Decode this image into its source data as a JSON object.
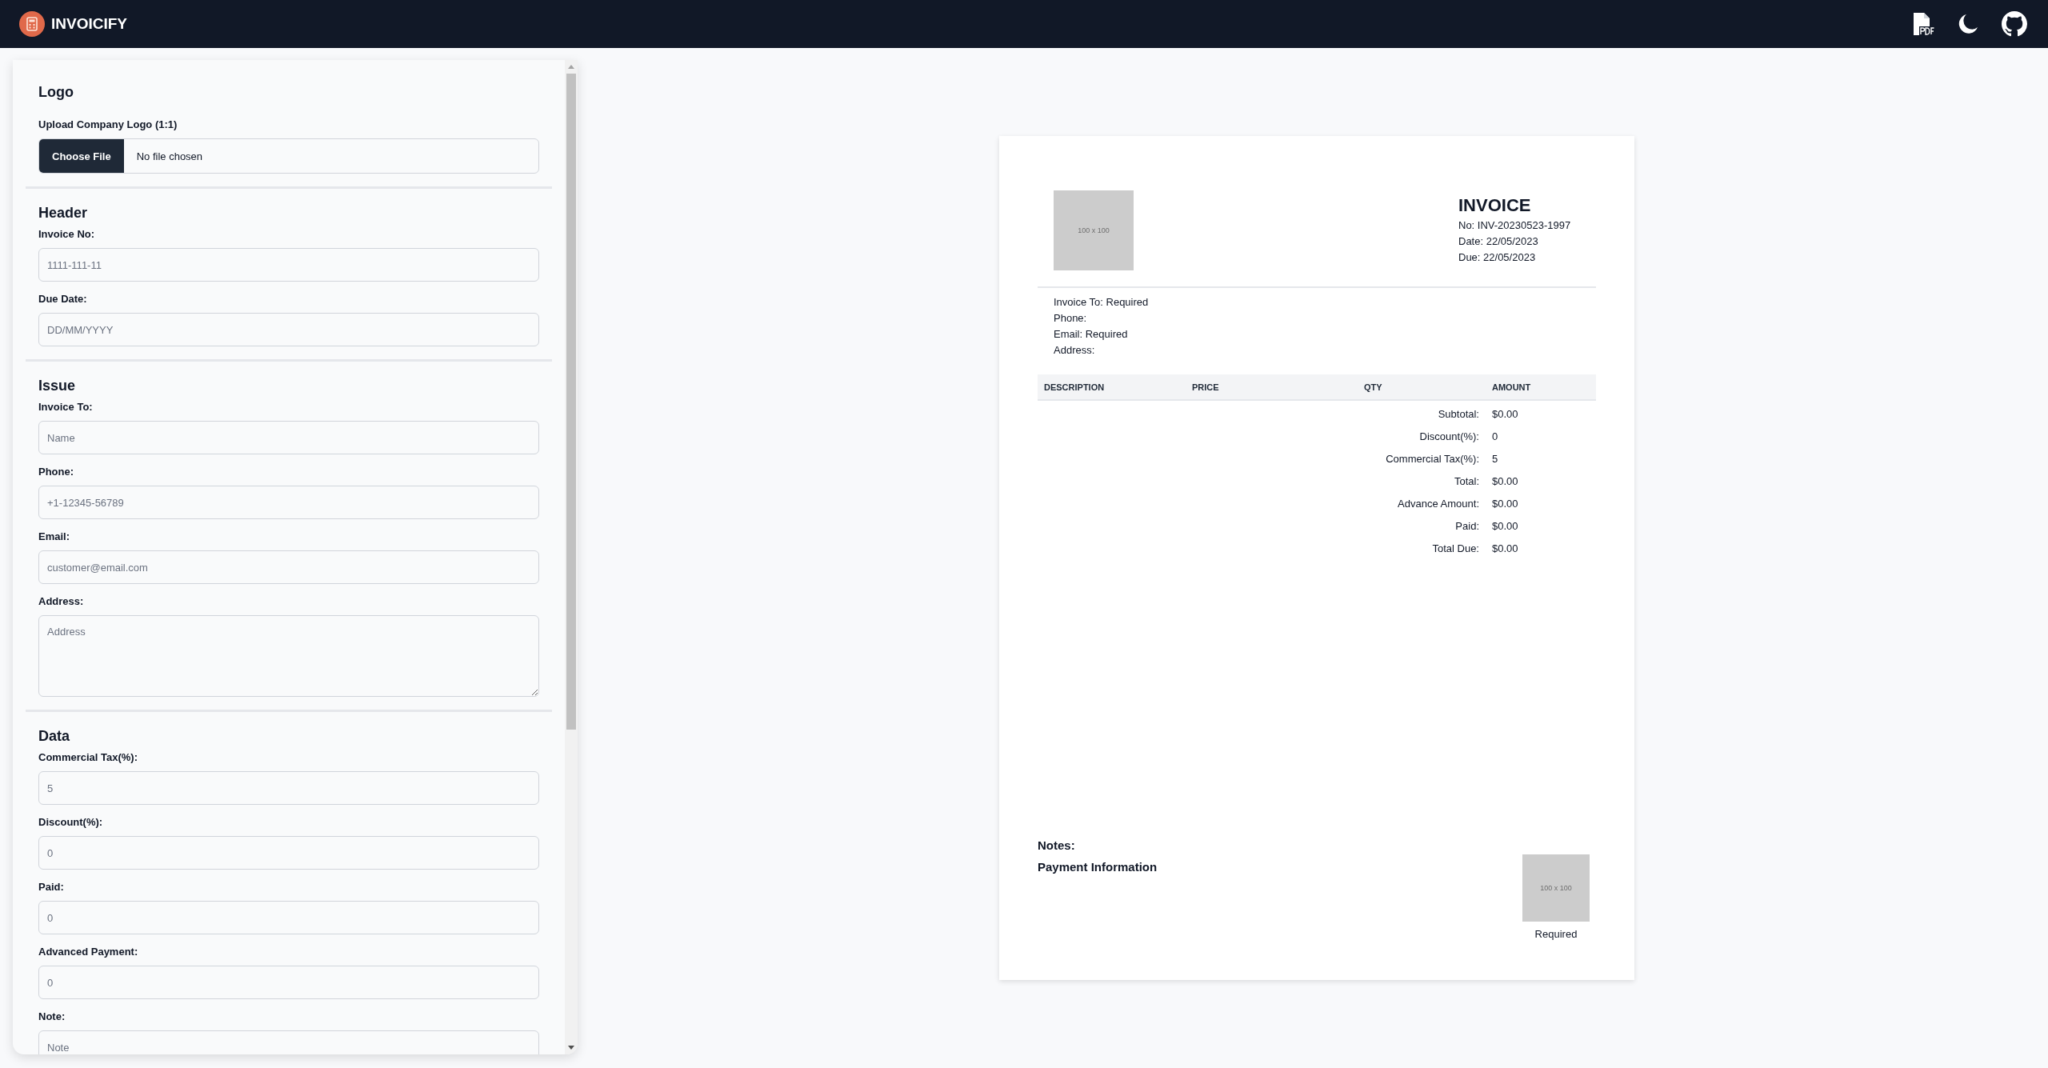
{
  "app": {
    "title": "INVOICIFY"
  },
  "form": {
    "sections": [
      {
        "title": "Logo",
        "fields": [
          {
            "kind": "file",
            "label": "Upload Company Logo (1:1)",
            "button": "Choose File",
            "value": "No file chosen"
          }
        ]
      },
      {
        "title": "Header",
        "fields": [
          {
            "kind": "text",
            "label": "Invoice No:",
            "placeholder": "1111-111-11"
          },
          {
            "kind": "text",
            "label": "Due Date:",
            "placeholder": "DD/MM/YYYY"
          }
        ]
      },
      {
        "title": "Issue",
        "fields": [
          {
            "kind": "text",
            "label": "Invoice To:",
            "placeholder": "Name"
          },
          {
            "kind": "text",
            "label": "Phone:",
            "placeholder": "+1-12345-56789"
          },
          {
            "kind": "text",
            "label": "Email:",
            "placeholder": "customer@email.com"
          },
          {
            "kind": "textarea",
            "label": "Address:",
            "placeholder": "Address"
          }
        ]
      },
      {
        "title": "Data",
        "fields": [
          {
            "kind": "text",
            "label": "Commercial Tax(%):",
            "placeholder": "5"
          },
          {
            "kind": "text",
            "label": "Discount(%):",
            "placeholder": "0"
          },
          {
            "kind": "text",
            "label": "Paid:",
            "placeholder": "0"
          },
          {
            "kind": "text",
            "label": "Advanced Payment:",
            "placeholder": "0"
          },
          {
            "kind": "text",
            "label": "Note:",
            "placeholder": "Note"
          }
        ]
      }
    ]
  },
  "invoice": {
    "logo_placeholder": "100 x 100",
    "title": "INVOICE",
    "meta": [
      "No: INV-20230523-1997",
      "Date: 22/05/2023",
      "Due: 22/05/2023"
    ],
    "bill_to": [
      "Invoice To: Required",
      "Phone:",
      "Email: Required",
      "Address:"
    ],
    "table": {
      "columns": [
        "DESCRIPTION",
        "PRICE",
        "QTY",
        "AMOUNT"
      ]
    },
    "totals": [
      {
        "label": "Subtotal:",
        "value": "$0.00"
      },
      {
        "label": "Discount(%):",
        "value": "0"
      },
      {
        "label": "Commercial Tax(%):",
        "value": "5"
      },
      {
        "label": "Total:",
        "value": "$0.00"
      },
      {
        "label": "Advance Amount:",
        "value": "$0.00"
      },
      {
        "label": "Paid:",
        "value": "$0.00"
      },
      {
        "label": "Total Due:",
        "value": "$0.00"
      }
    ],
    "notes_label": "Notes:",
    "payment_label": "Payment Information",
    "signature": {
      "placeholder": "100 x 100",
      "caption": "Required"
    }
  }
}
